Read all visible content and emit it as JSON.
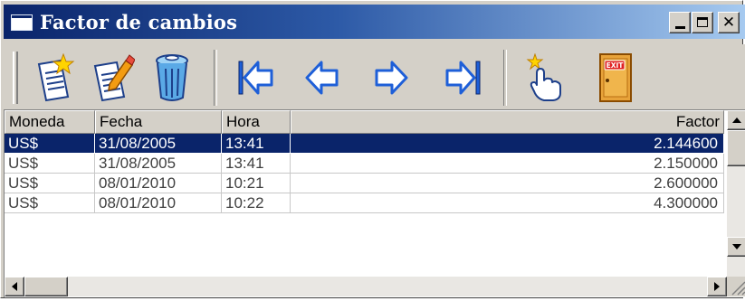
{
  "window": {
    "title": "Factor de cambios",
    "buttons": {
      "minimize": "_",
      "maximize": "□",
      "close": "✕"
    }
  },
  "toolbar": {
    "buttons": [
      {
        "name": "new-record-button",
        "icon": "new-document-icon"
      },
      {
        "name": "edit-record-button",
        "icon": "edit-document-icon"
      },
      {
        "name": "delete-record-button",
        "icon": "trash-can-icon"
      },
      {
        "name": "first-record-button",
        "icon": "first-arrow-icon"
      },
      {
        "name": "previous-record-button",
        "icon": "previous-arrow-icon"
      },
      {
        "name": "next-record-button",
        "icon": "next-arrow-icon"
      },
      {
        "name": "last-record-button",
        "icon": "last-arrow-icon"
      },
      {
        "name": "select-button",
        "icon": "pointing-hand-icon"
      },
      {
        "name": "exit-button",
        "icon": "exit-door-icon",
        "label": "EXIT"
      }
    ]
  },
  "grid": {
    "columns": [
      "Moneda",
      "Fecha",
      "Hora",
      "Factor"
    ],
    "rows": [
      {
        "moneda": "US$",
        "fecha": "31/08/2005",
        "hora": "13:41",
        "factor": "2.144600",
        "selected": true
      },
      {
        "moneda": "US$",
        "fecha": "31/08/2005",
        "hora": "13:41",
        "factor": "2.150000",
        "selected": false
      },
      {
        "moneda": "US$",
        "fecha": "08/01/2010",
        "hora": "10:21",
        "factor": "2.600000",
        "selected": false
      },
      {
        "moneda": "US$",
        "fecha": "08/01/2010",
        "hora": "10:22",
        "factor": "4.300000",
        "selected": false
      }
    ]
  },
  "colors": {
    "title_gradient_start": "#0a246a",
    "title_gradient_end": "#a6caf0",
    "selection": "#0a246a",
    "face": "#d4d0c8",
    "arrow_blue": "#1e5fd8"
  }
}
